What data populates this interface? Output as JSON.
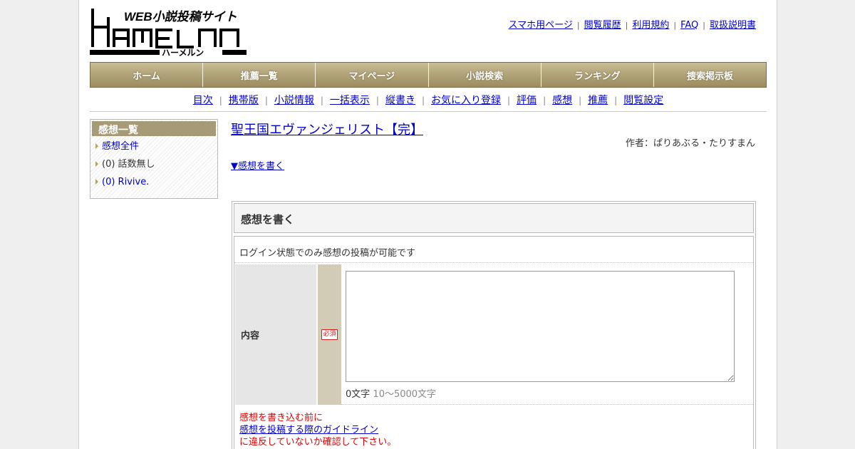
{
  "header": {
    "logo_text": "HAMELN",
    "logo_tagline": "WEB小説投稿サイト",
    "logo_kana": "ハーメルン",
    "top_links": [
      "スマホ用ページ",
      "閲覧履歴",
      "利用規約",
      "FAQ",
      "取扱説明書"
    ]
  },
  "main_nav": [
    "ホーム",
    "推薦一覧",
    "マイページ",
    "小説検索",
    "ランキング",
    "捜索掲示板"
  ],
  "sub_nav": [
    "目次",
    "携帯版",
    "小説情報",
    "一括表示",
    "縦書き",
    "お気に入り登録",
    "評価",
    "感想",
    "推薦",
    "閲覧設定"
  ],
  "sidebar": {
    "title": "感想一覧",
    "items": [
      {
        "label": "感想全件",
        "link": true
      },
      {
        "label": "(0) 話数無し",
        "link": false
      },
      {
        "label": "(0) Rivive.",
        "link": true
      }
    ]
  },
  "novel": {
    "title": "聖王国エヴァンジェリスト【完】",
    "author": "作者：ぱりあぶる・たりすまん",
    "write_link": "▼感想を書く"
  },
  "form": {
    "heading": "感想を書く",
    "login_note": "ログイン状態でのみ感想の投稿が可能です",
    "field_label": "内容",
    "required_badge": "必須",
    "char_count": "0文字",
    "char_range": "10～5000文字",
    "guide_before": "感想を書き込む前に",
    "guide_link": "感想を投稿する際のガイドライン",
    "guide_after": "に違反していないか確認して下さい。"
  },
  "colors": {
    "nav_bg": "#b3a57a",
    "sidebar_title_bg": "#a79a76",
    "link": "#0000cc",
    "warning": "#dd0000"
  }
}
